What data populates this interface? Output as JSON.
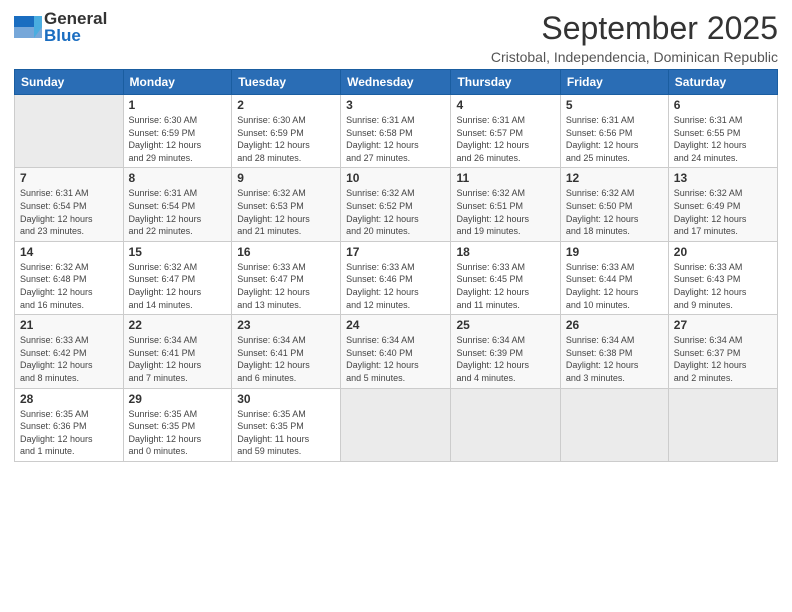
{
  "header": {
    "logo_general": "General",
    "logo_blue": "Blue",
    "month_year": "September 2025",
    "location": "Cristobal, Independencia, Dominican Republic"
  },
  "columns": [
    "Sunday",
    "Monday",
    "Tuesday",
    "Wednesday",
    "Thursday",
    "Friday",
    "Saturday"
  ],
  "weeks": [
    {
      "row": 1,
      "days": [
        {
          "num": "",
          "info": ""
        },
        {
          "num": "1",
          "info": "Sunrise: 6:30 AM\nSunset: 6:59 PM\nDaylight: 12 hours\nand 29 minutes."
        },
        {
          "num": "2",
          "info": "Sunrise: 6:30 AM\nSunset: 6:59 PM\nDaylight: 12 hours\nand 28 minutes."
        },
        {
          "num": "3",
          "info": "Sunrise: 6:31 AM\nSunset: 6:58 PM\nDaylight: 12 hours\nand 27 minutes."
        },
        {
          "num": "4",
          "info": "Sunrise: 6:31 AM\nSunset: 6:57 PM\nDaylight: 12 hours\nand 26 minutes."
        },
        {
          "num": "5",
          "info": "Sunrise: 6:31 AM\nSunset: 6:56 PM\nDaylight: 12 hours\nand 25 minutes."
        },
        {
          "num": "6",
          "info": "Sunrise: 6:31 AM\nSunset: 6:55 PM\nDaylight: 12 hours\nand 24 minutes."
        }
      ]
    },
    {
      "row": 2,
      "days": [
        {
          "num": "7",
          "info": "Sunrise: 6:31 AM\nSunset: 6:54 PM\nDaylight: 12 hours\nand 23 minutes."
        },
        {
          "num": "8",
          "info": "Sunrise: 6:31 AM\nSunset: 6:54 PM\nDaylight: 12 hours\nand 22 minutes."
        },
        {
          "num": "9",
          "info": "Sunrise: 6:32 AM\nSunset: 6:53 PM\nDaylight: 12 hours\nand 21 minutes."
        },
        {
          "num": "10",
          "info": "Sunrise: 6:32 AM\nSunset: 6:52 PM\nDaylight: 12 hours\nand 20 minutes."
        },
        {
          "num": "11",
          "info": "Sunrise: 6:32 AM\nSunset: 6:51 PM\nDaylight: 12 hours\nand 19 minutes."
        },
        {
          "num": "12",
          "info": "Sunrise: 6:32 AM\nSunset: 6:50 PM\nDaylight: 12 hours\nand 18 minutes."
        },
        {
          "num": "13",
          "info": "Sunrise: 6:32 AM\nSunset: 6:49 PM\nDaylight: 12 hours\nand 17 minutes."
        }
      ]
    },
    {
      "row": 3,
      "days": [
        {
          "num": "14",
          "info": "Sunrise: 6:32 AM\nSunset: 6:48 PM\nDaylight: 12 hours\nand 16 minutes."
        },
        {
          "num": "15",
          "info": "Sunrise: 6:32 AM\nSunset: 6:47 PM\nDaylight: 12 hours\nand 14 minutes."
        },
        {
          "num": "16",
          "info": "Sunrise: 6:33 AM\nSunset: 6:47 PM\nDaylight: 12 hours\nand 13 minutes."
        },
        {
          "num": "17",
          "info": "Sunrise: 6:33 AM\nSunset: 6:46 PM\nDaylight: 12 hours\nand 12 minutes."
        },
        {
          "num": "18",
          "info": "Sunrise: 6:33 AM\nSunset: 6:45 PM\nDaylight: 12 hours\nand 11 minutes."
        },
        {
          "num": "19",
          "info": "Sunrise: 6:33 AM\nSunset: 6:44 PM\nDaylight: 12 hours\nand 10 minutes."
        },
        {
          "num": "20",
          "info": "Sunrise: 6:33 AM\nSunset: 6:43 PM\nDaylight: 12 hours\nand 9 minutes."
        }
      ]
    },
    {
      "row": 4,
      "days": [
        {
          "num": "21",
          "info": "Sunrise: 6:33 AM\nSunset: 6:42 PM\nDaylight: 12 hours\nand 8 minutes."
        },
        {
          "num": "22",
          "info": "Sunrise: 6:34 AM\nSunset: 6:41 PM\nDaylight: 12 hours\nand 7 minutes."
        },
        {
          "num": "23",
          "info": "Sunrise: 6:34 AM\nSunset: 6:41 PM\nDaylight: 12 hours\nand 6 minutes."
        },
        {
          "num": "24",
          "info": "Sunrise: 6:34 AM\nSunset: 6:40 PM\nDaylight: 12 hours\nand 5 minutes."
        },
        {
          "num": "25",
          "info": "Sunrise: 6:34 AM\nSunset: 6:39 PM\nDaylight: 12 hours\nand 4 minutes."
        },
        {
          "num": "26",
          "info": "Sunrise: 6:34 AM\nSunset: 6:38 PM\nDaylight: 12 hours\nand 3 minutes."
        },
        {
          "num": "27",
          "info": "Sunrise: 6:34 AM\nSunset: 6:37 PM\nDaylight: 12 hours\nand 2 minutes."
        }
      ]
    },
    {
      "row": 5,
      "days": [
        {
          "num": "28",
          "info": "Sunrise: 6:35 AM\nSunset: 6:36 PM\nDaylight: 12 hours\nand 1 minute."
        },
        {
          "num": "29",
          "info": "Sunrise: 6:35 AM\nSunset: 6:35 PM\nDaylight: 12 hours\nand 0 minutes."
        },
        {
          "num": "30",
          "info": "Sunrise: 6:35 AM\nSunset: 6:35 PM\nDaylight: 11 hours\nand 59 minutes."
        },
        {
          "num": "",
          "info": ""
        },
        {
          "num": "",
          "info": ""
        },
        {
          "num": "",
          "info": ""
        },
        {
          "num": "",
          "info": ""
        }
      ]
    }
  ]
}
